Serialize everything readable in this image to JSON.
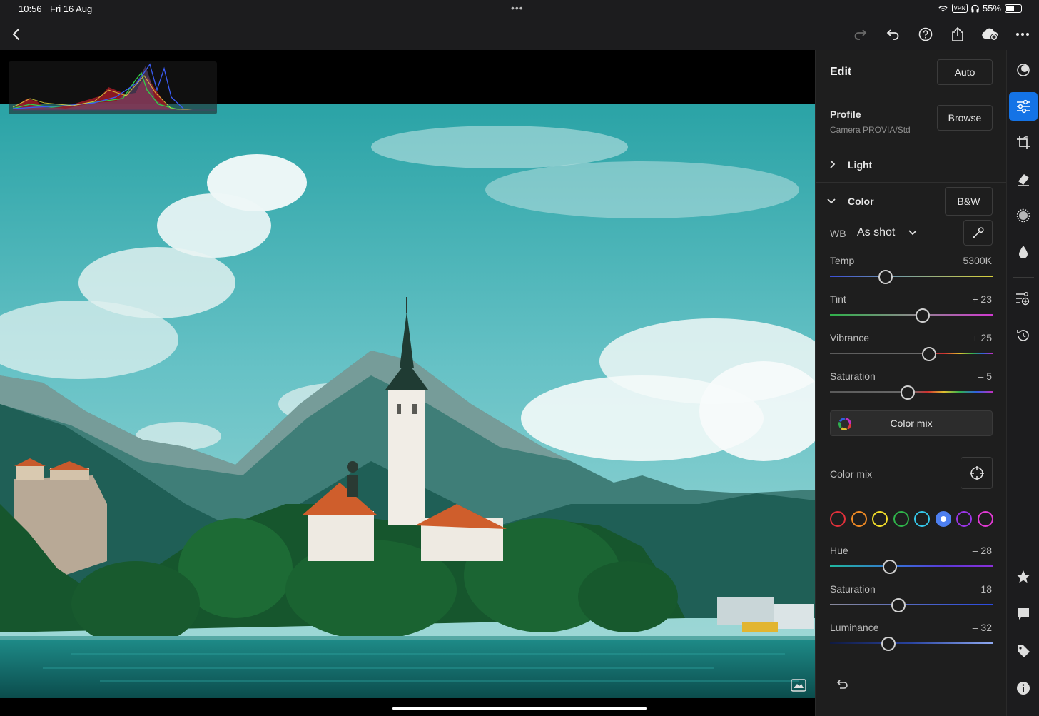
{
  "status_bar": {
    "time": "10:56",
    "date": "Fri 16 Aug",
    "vpn": "VPN",
    "battery": "55%",
    "battery_level": 0.55
  },
  "toolbar": {
    "icons": [
      "back-icon",
      "redo-icon",
      "undo-icon",
      "help-icon",
      "share-icon",
      "cloud-add-icon",
      "more-icon"
    ]
  },
  "panel": {
    "edit_title": "Edit",
    "auto_label": "Auto",
    "profile": {
      "title": "Profile",
      "value": "Camera PROVIA/Std",
      "browse_label": "Browse"
    },
    "light": {
      "label": "Light"
    },
    "color": {
      "label": "Color",
      "bw_label": "B&W",
      "wb_label": "WB",
      "wb_value": "As shot",
      "sliders": [
        {
          "label": "Temp",
          "value": "5300K",
          "position": 0.34
        },
        {
          "label": "Tint",
          "value": "+ 23",
          "position": 0.57
        },
        {
          "label": "Vibrance",
          "value": "+ 25",
          "position": 0.61
        },
        {
          "label": "Saturation",
          "value": "– 5",
          "position": 0.48
        }
      ],
      "color_mix_button": "Color mix"
    },
    "color_mix": {
      "title": "Color mix",
      "swatches": [
        {
          "name": "red",
          "color": "#e0303a",
          "selected": false
        },
        {
          "name": "orange",
          "color": "#f08a24",
          "selected": false
        },
        {
          "name": "yellow",
          "color": "#f2dd2a",
          "selected": false
        },
        {
          "name": "green",
          "color": "#2fb34a",
          "selected": false
        },
        {
          "name": "aqua",
          "color": "#35c6e8",
          "selected": false
        },
        {
          "name": "blue",
          "color": "#4d7ff0",
          "selected": true
        },
        {
          "name": "purple",
          "color": "#9b35e6",
          "selected": false
        },
        {
          "name": "magenta",
          "color": "#e23ad4",
          "selected": false
        }
      ],
      "sliders": [
        {
          "label": "Hue",
          "value": "– 28",
          "position": 0.37
        },
        {
          "label": "Saturation",
          "value": "– 18",
          "position": 0.42
        },
        {
          "label": "Luminance",
          "value": "– 32",
          "position": 0.36
        }
      ]
    }
  },
  "rail": {
    "icons": [
      "presets-icon",
      "edit-sliders-icon",
      "crop-icon",
      "healing-icon",
      "masking-icon",
      "blur-icon",
      "versions-icon",
      "history-icon",
      "star-icon",
      "comment-icon",
      "tag-icon",
      "info-icon"
    ],
    "active": "edit-sliders-icon"
  }
}
